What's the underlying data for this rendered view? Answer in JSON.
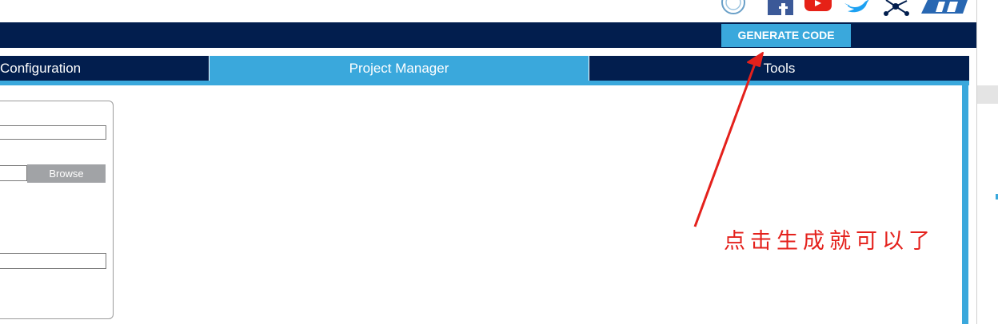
{
  "header": {
    "icons": [
      "anniversary-badge-icon",
      "facebook-icon",
      "youtube-icon",
      "twitter-icon",
      "network-icon",
      "st-logo-icon"
    ],
    "generate_label": "GENERATE CODE"
  },
  "tabs": [
    {
      "label": "Configuration",
      "active": false
    },
    {
      "label": "Project Manager",
      "active": true
    },
    {
      "label": "Tools",
      "active": false
    }
  ],
  "form": {
    "browse_label": "Browse",
    "project_name_value": "",
    "location_value": "",
    "toolchain_value": ""
  },
  "annotation": {
    "text": "点击生成就可以了",
    "color": "#e4211c"
  },
  "colors": {
    "navy": "#021e4e",
    "accent": "#3aa8dc",
    "browse_gray": "#a1a3a6"
  }
}
